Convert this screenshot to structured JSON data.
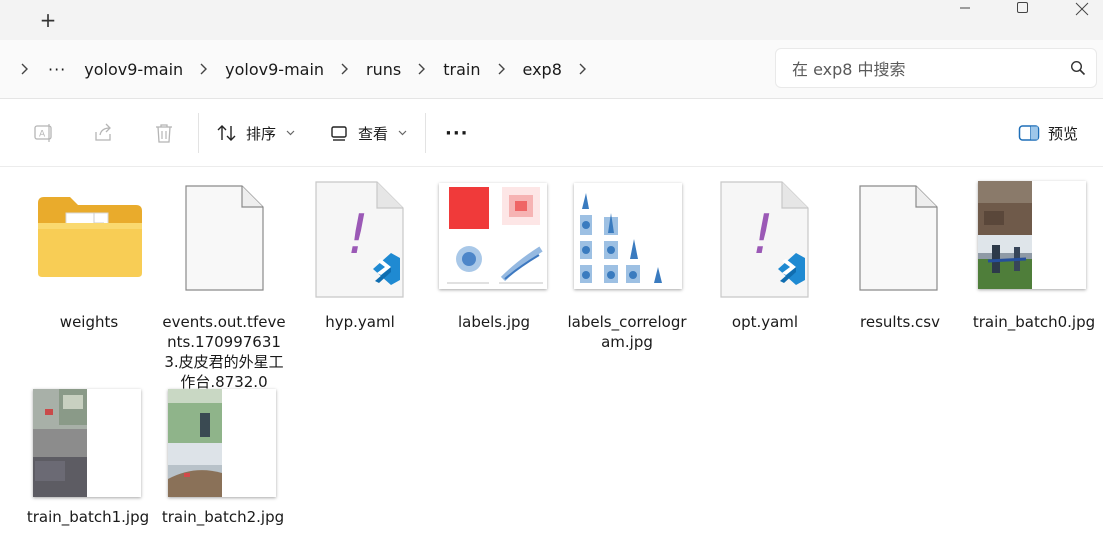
{
  "titlebar": {
    "new_tab_symbol": "+"
  },
  "address": {
    "overflow_symbol": "···",
    "crumbs": [
      "yolov9-main",
      "yolov9-main",
      "runs",
      "train",
      "exp8"
    ]
  },
  "search": {
    "placeholder": "在 exp8 中搜索"
  },
  "toolbar": {
    "sort_label": "排序",
    "view_label": "查看",
    "more_symbol": "···",
    "preview_label": "预览"
  },
  "files": [
    {
      "name": "weights",
      "type": "folder"
    },
    {
      "name": "events.out.tfevents.1709976313.皮皮君的外星工作台.8732.0",
      "type": "file"
    },
    {
      "name": "hyp.yaml",
      "type": "yaml"
    },
    {
      "name": "labels.jpg",
      "type": "image"
    },
    {
      "name": "labels_correlogram.jpg",
      "type": "image"
    },
    {
      "name": "opt.yaml",
      "type": "yaml"
    },
    {
      "name": "results.csv",
      "type": "file"
    },
    {
      "name": "train_batch0.jpg",
      "type": "image"
    },
    {
      "name": "train_batch1.jpg",
      "type": "image"
    },
    {
      "name": "train_batch2.jpg",
      "type": "image"
    }
  ],
  "icons": {
    "yaml_mark": "!",
    "accent": "#9b59b6",
    "vscode_blue": "#1f8ad2",
    "folder_yellow": "#f6c444"
  }
}
